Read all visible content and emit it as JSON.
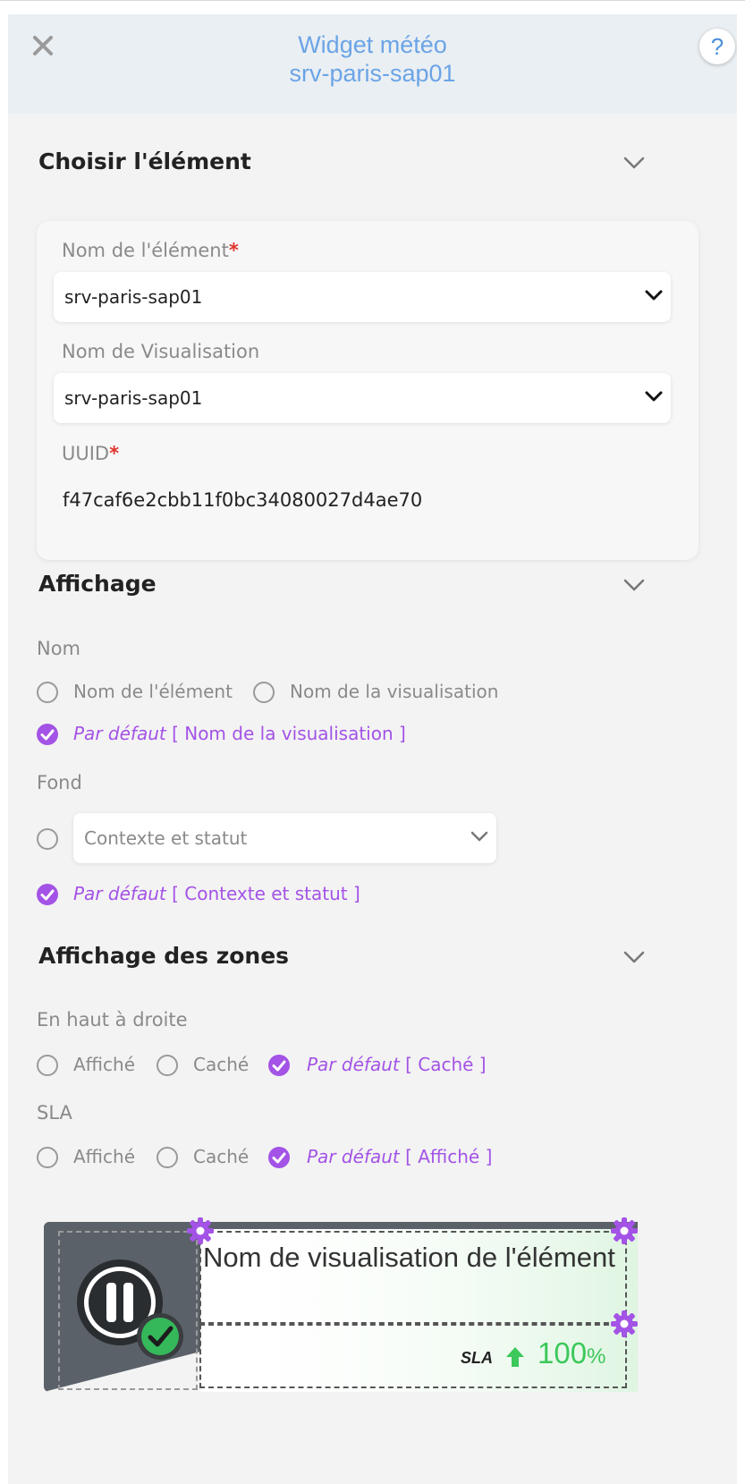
{
  "header": {
    "title_line1": "Widget météo",
    "title_line2": "srv-paris-sap01",
    "help_label": "?"
  },
  "section_element": {
    "title": "Choisir l'élément",
    "name_label": "Nom de l'élément",
    "name_value": "srv-paris-sap01",
    "visu_label": "Nom de Visualisation",
    "visu_value": "srv-paris-sap01",
    "uuid_label": "UUID",
    "uuid_value": "f47caf6e2cbb11f0bc34080027d4ae70",
    "required_mark": "*"
  },
  "section_display": {
    "title": "Affichage",
    "nom_label": "Nom",
    "option_element": "Nom de l'élément",
    "option_visu": "Nom de la visualisation",
    "default_prefix": "Par défaut",
    "default_nom": "[ Nom de la visualisation ]",
    "fond_label": "Fond",
    "fond_select": "Contexte et statut",
    "default_fond": "[ Contexte et statut ]"
  },
  "section_zones": {
    "title": "Affichage des zones",
    "top_right_label": "En haut à droite",
    "sla_label": "SLA",
    "option_shown": "Affiché",
    "option_hidden": "Caché",
    "default_prefix": "Par défaut",
    "default_top_right": "[ Caché ]",
    "default_sla": "[ Affiché ]"
  },
  "preview": {
    "name": "Nom de visualisation de l'élément",
    "sla_label": "SLA",
    "sla_value": "100",
    "sla_unit": "%"
  },
  "colors": {
    "accent": "#a353e6",
    "title_blue": "#6ba4e6",
    "required": "#e0352b",
    "sla_green": "#3cc85a"
  }
}
